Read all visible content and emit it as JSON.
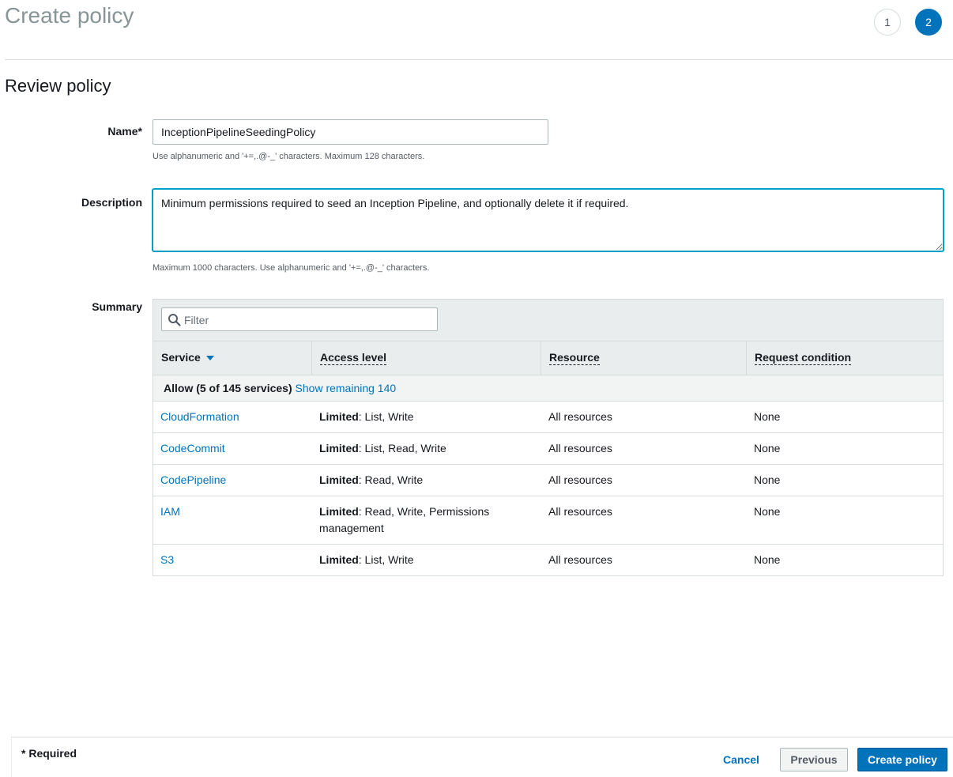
{
  "header": {
    "title": "Create policy",
    "steps": [
      "1",
      "2"
    ],
    "active_step": "2"
  },
  "review": {
    "section_title": "Review policy",
    "name_label": "Name*",
    "name_value": "InceptionPipelineSeedingPolicy",
    "name_hint": "Use alphanumeric and '+=,.@-_' characters. Maximum 128 characters.",
    "description_label": "Description",
    "description_value": "Minimum permissions required to seed an Inception Pipeline, and optionally delete it if required.",
    "description_hint": "Maximum 1000 characters. Use alphanumeric and '+=,.@-_' characters.",
    "summary_label": "Summary"
  },
  "summary": {
    "filter_placeholder": "Filter",
    "columns": [
      "Service",
      "Access level",
      "Resource",
      "Request condition"
    ],
    "group_label": "Allow (5 of 145 services)",
    "group_link": "Show remaining 140",
    "rows": [
      {
        "service": "CloudFormation",
        "level_bold": "Limited",
        "level_rest": ": List, Write",
        "resource": "All resources",
        "condition": "None"
      },
      {
        "service": "CodeCommit",
        "level_bold": "Limited",
        "level_rest": ": List, Read, Write",
        "resource": "All resources",
        "condition": "None"
      },
      {
        "service": "CodePipeline",
        "level_bold": "Limited",
        "level_rest": ": Read, Write",
        "resource": "All resources",
        "condition": "None"
      },
      {
        "service": "IAM",
        "level_bold": "Limited",
        "level_rest": ": Read, Write, Permissions management",
        "resource": "All resources",
        "condition": "None"
      },
      {
        "service": "S3",
        "level_bold": "Limited",
        "level_rest": ": List, Write",
        "resource": "All resources",
        "condition": "None"
      }
    ]
  },
  "footer": {
    "required_note": "* Required",
    "cancel_label": "Cancel",
    "previous_label": "Previous",
    "create_label": "Create policy"
  },
  "colors": {
    "accent": "#0073bb",
    "focus": "#00a1c9",
    "title_gray": "#879596"
  }
}
